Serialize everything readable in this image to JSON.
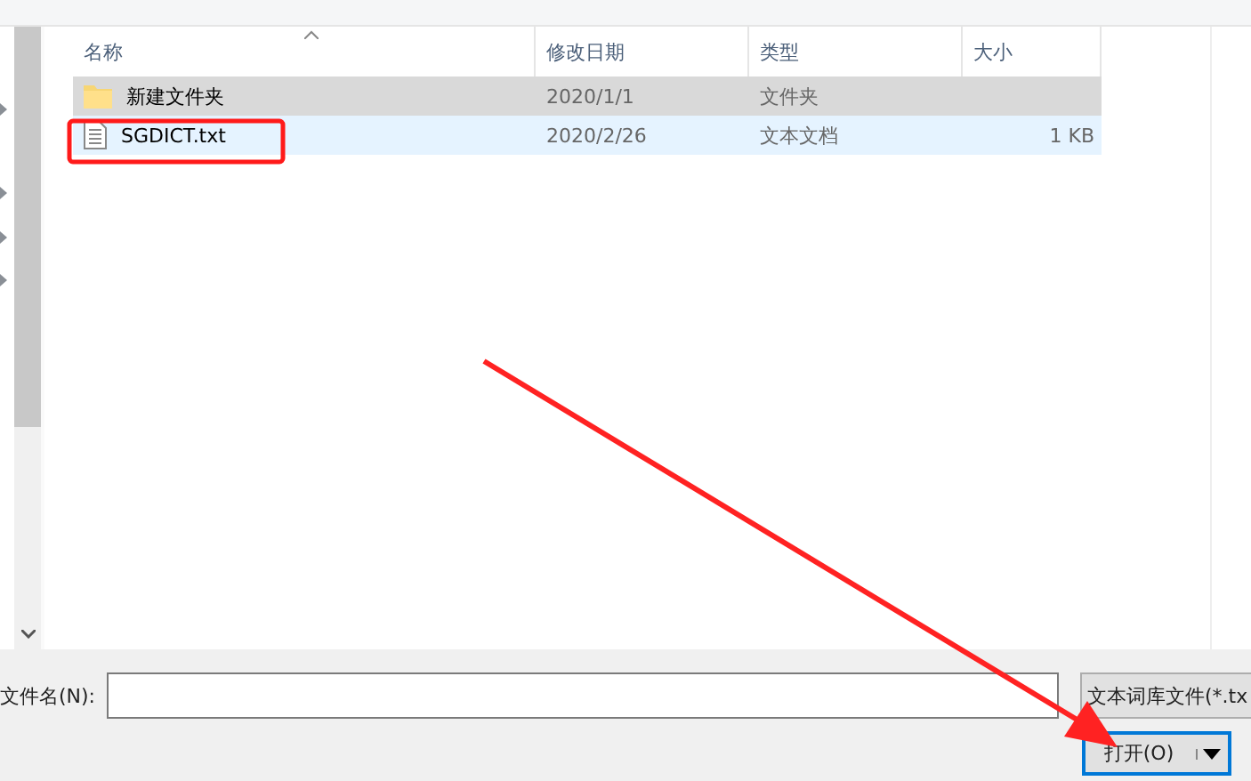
{
  "file_list": {
    "columns": [
      {
        "label": "名称",
        "sorted": true
      },
      {
        "label": "修改日期",
        "sorted": false
      },
      {
        "label": "类型",
        "sorted": false
      },
      {
        "label": "大小",
        "sorted": false
      }
    ],
    "rows": [
      {
        "kind": "folder",
        "name": "新建文件夹",
        "date": "2020/1/1",
        "type": "文件夹",
        "selected": true,
        "hover": false
      },
      {
        "kind": "file",
        "name": "SGDICT.txt",
        "date": "2020/2/26",
        "type": "文本文档",
        "size": "1 KB",
        "selected": false,
        "hover": true
      }
    ]
  },
  "filename": {
    "label": "文件名(N):"
  },
  "filter": {
    "value": "文本词库文件(*.tx"
  },
  "open_button": {
    "label": "打开(O)"
  },
  "annotations": {
    "highlight_box": true,
    "arrow": true
  }
}
